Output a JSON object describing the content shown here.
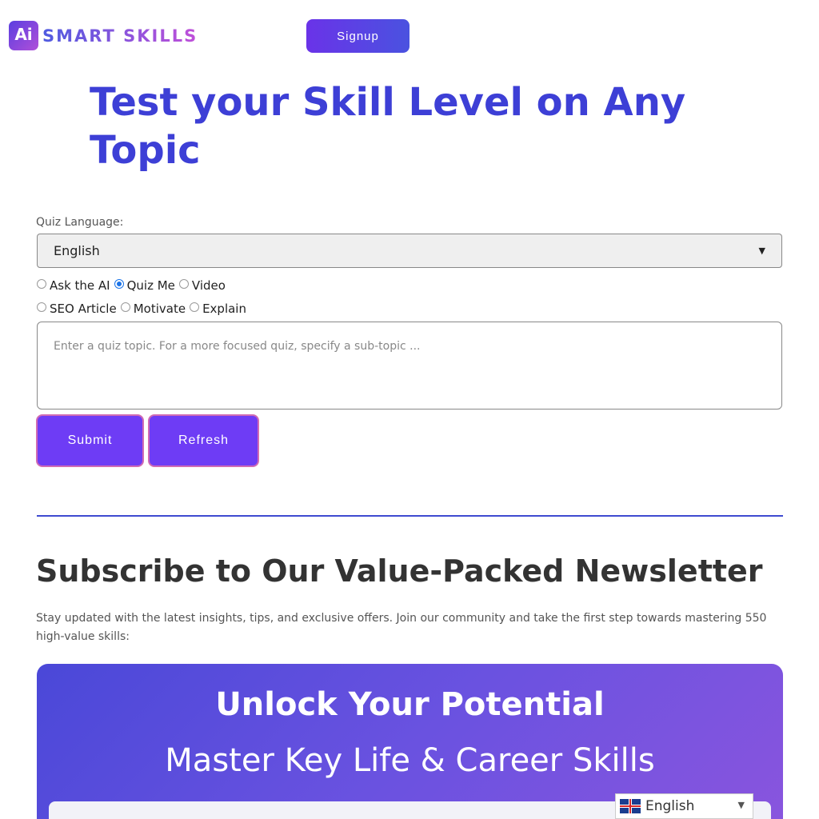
{
  "header": {
    "logo_mark": "Ai",
    "logo_text": "SMART SKILLS",
    "signup_label": "Signup"
  },
  "hero": {
    "title": "Test your Skill Level on Any Topic"
  },
  "form": {
    "language_label": "Quiz Language:",
    "language_selected": "English",
    "modes": [
      {
        "label": "Ask the AI",
        "checked": false
      },
      {
        "label": "Quiz Me",
        "checked": true
      },
      {
        "label": "Video",
        "checked": false
      },
      {
        "label": "SEO Article",
        "checked": false
      },
      {
        "label": "Motivate",
        "checked": false
      },
      {
        "label": "Explain",
        "checked": false
      }
    ],
    "topic_placeholder": "Enter a quiz topic. For a more focused quiz, specify a sub-topic ...",
    "submit_label": "Submit",
    "refresh_label": "Refresh"
  },
  "newsletter": {
    "title": "Subscribe to Our Value-Packed Newsletter",
    "description": "Stay updated with the latest insights, tips, and exclusive offers. Join our community and take the first step towards mastering 550 high-value skills:",
    "promo_icon": "",
    "promo_title": "Unlock Your Potential",
    "promo_subtitle": "Master Key Life & Career Skills"
  },
  "language_switcher": {
    "code": "en",
    "label": "English"
  }
}
